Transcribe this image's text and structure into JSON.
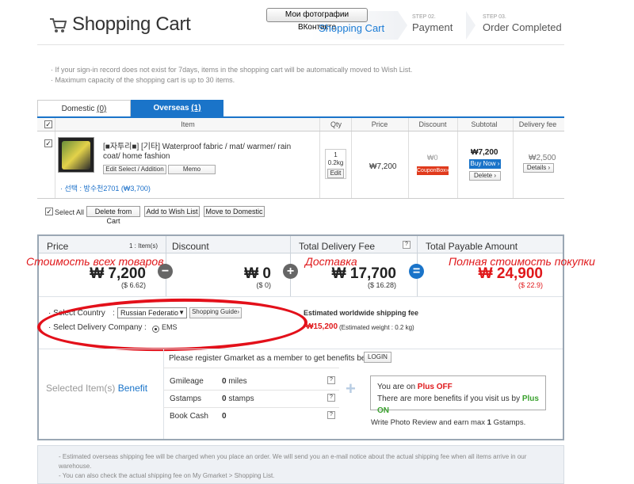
{
  "header": {
    "title": "Shopping Cart",
    "vk_button": "Мои фотографии ВКонтакте",
    "steps": [
      {
        "num": "",
        "label": "Shopping Cart"
      },
      {
        "num": "STEP 02.",
        "label": "Payment"
      },
      {
        "num": "STEP 03.",
        "label": "Order Completed"
      }
    ]
  },
  "notes": [
    "· If your sign-in record does not exist for 7days, items in the shopping cart will be automatically moved to Wish List.",
    "· Maximum capacity of the shopping cart is up to 30 items."
  ],
  "tabs": {
    "domestic": {
      "label": "Domestic",
      "count": "(0)"
    },
    "overseas": {
      "label": "Overseas",
      "count": "(1)"
    }
  },
  "table": {
    "headers": {
      "item": "Item",
      "qty": "Qty",
      "price": "Price",
      "discount": "Discount",
      "subtotal": "Subtotal",
      "delivery": "Delivery fee"
    },
    "row": {
      "name": "[■자투리■] [기타] Waterproof fabric / mat/ warmer/ rain coat/ home fashion",
      "edit_select": "Edit Select / Addition",
      "memo": "Memo",
      "option": "· 선택 : 방수천2701 (₩3,700)",
      "qty": "1",
      "weight": "0.2kg",
      "qty_edit": "Edit",
      "price": "₩7,200",
      "discount": "₩0",
      "coupon": "CouponBox»",
      "subtotal": "₩7,200",
      "buy_now": "Buy Now ›",
      "delete": "Delete ›",
      "delivery_fee": "₩2,500",
      "details": "Details ›"
    }
  },
  "actions": {
    "select_all": "Select All",
    "delete_from_cart": "Delete from Cart",
    "add_wish": "Add to Wish List",
    "move_domestic": "Move to Domestic"
  },
  "summary": {
    "price": {
      "label": "Price",
      "items": "1 : Item(s)",
      "amount": "₩ 7,200",
      "usd": "($ 6.62)",
      "ru": "Стоимость всех товаров"
    },
    "discount": {
      "label": "Discount",
      "amount": "₩ 0",
      "usd": "($ 0)"
    },
    "delivery": {
      "label": "Total Delivery Fee",
      "amount": "₩ 17,700",
      "usd": "($ 16.28)",
      "ru": "Доставка"
    },
    "total": {
      "label": "Total Payable Amount",
      "amount": "₩ 24,900",
      "usd": "($ 22.9)",
      "ru": "Полная стоимость покупки"
    },
    "q": "?"
  },
  "shipping": {
    "country_label": "· Select Country",
    "country_value": "Russian Federatio",
    "guide": "Shopping Guide›",
    "company_label": "· Select Delivery Company",
    "company_value": "EMS",
    "estimate_title": "Estimated worldwide shipping fee",
    "estimate_value": "₩15,200",
    "estimate_weight": "(Estimated weight : 0.2 kg)"
  },
  "benefit": {
    "title_gray": "Selected Item(s)",
    "title_blue": "Benefit",
    "register": "Please register Gmarket as a member to get benefits below.",
    "login": "LOGIN",
    "rows": [
      {
        "label": "Gmileage",
        "value": "0",
        "unit": "miles"
      },
      {
        "label": "Gstamps",
        "value": "0",
        "unit": "stamps"
      },
      {
        "label": "Book Cash",
        "value": "0",
        "unit": ""
      }
    ],
    "plus_line1a": "You are on",
    "plus_line1b": "Plus OFF",
    "plus_line2a": "There are more benefits if you visit us by",
    "plus_line2b": "Plus ON",
    "review": "Write Photo Review and earn max",
    "review_count": "1",
    "review_unit": "Gstamps."
  },
  "footer": {
    "line1": "- Estimated overseas shipping fee will be charged when you place an order. We will send you an e-mail notice about the actual shipping fee when all items arrive in our warehouse.",
    "line2": "- You can also check the actual shipping fee on My Gmarket > Shopping List."
  },
  "colors": {
    "accent": "#1a74c9",
    "red": "#e0181b",
    "plus_green": "#3aa12e"
  }
}
